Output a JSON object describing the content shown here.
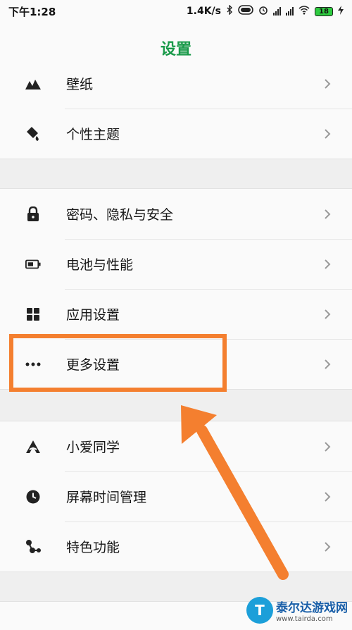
{
  "status_bar": {
    "time": "下午1:28",
    "speed": "1.4K/s",
    "battery": "18"
  },
  "header": {
    "title": "设置"
  },
  "groups": [
    {
      "items": [
        {
          "label": "壁纸",
          "icon": "wallpaper-icon"
        },
        {
          "label": "个性主题",
          "icon": "theme-icon"
        }
      ]
    },
    {
      "items": [
        {
          "label": "密码、隐私与安全",
          "icon": "lock-icon"
        },
        {
          "label": "电池与性能",
          "icon": "battery-icon"
        },
        {
          "label": "应用设置",
          "icon": "apps-grid-icon"
        },
        {
          "label": "更多设置",
          "icon": "more-dots-icon"
        }
      ]
    },
    {
      "items": [
        {
          "label": "小爱同学",
          "icon": "xiaoai-icon"
        },
        {
          "label": "屏幕时间管理",
          "icon": "clock-icon"
        },
        {
          "label": "特色功能",
          "icon": "features-icon"
        }
      ]
    }
  ],
  "annotation": {
    "color": "#f47f2f",
    "highlighted_item": "更多设置"
  },
  "watermark": {
    "name": "泰尔达游戏网",
    "url": "www.tairda.com"
  },
  "colors": {
    "accent": "#1a9a4a",
    "background": "#efefef",
    "card": "#fafafa"
  }
}
